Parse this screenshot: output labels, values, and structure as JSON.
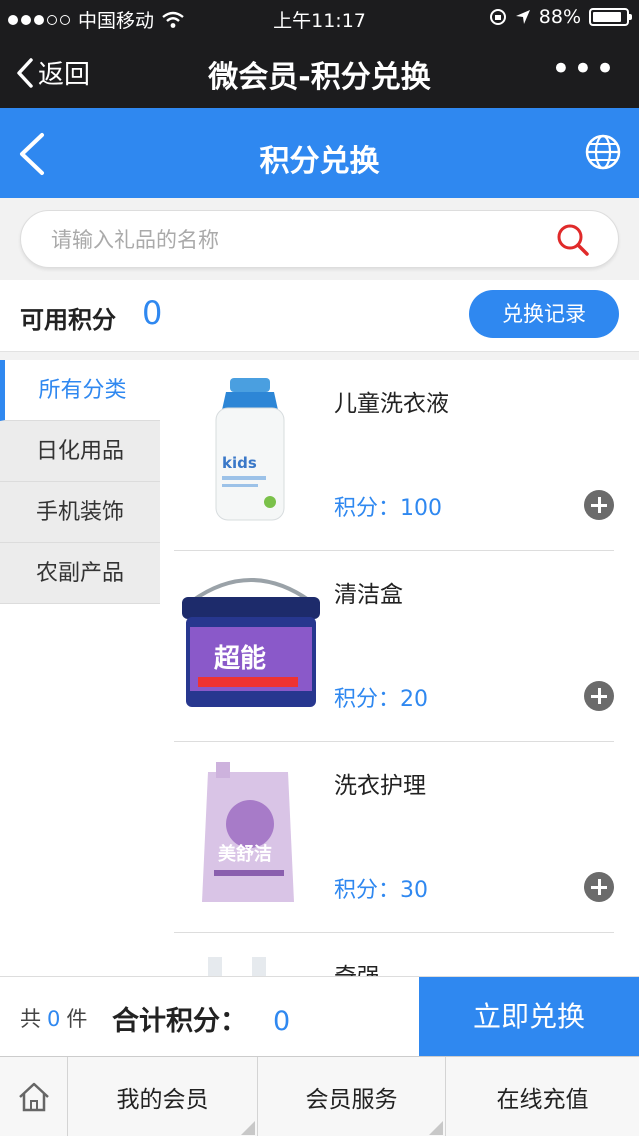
{
  "status_bar": {
    "carrier": "中国移动",
    "time": "上午11:17",
    "battery": "88%",
    "battery_level": 0.88
  },
  "wechat_nav": {
    "back_label": "返回",
    "title": "微会员-积分兑换",
    "more": "•••"
  },
  "header": {
    "title": "积分兑换",
    "back_icon": "chevron-left-icon",
    "globe_icon": "globe-icon"
  },
  "search": {
    "placeholder": "请输入礼品的名称",
    "icon": "search-icon"
  },
  "points": {
    "label": "可用积分",
    "value": "0",
    "history_button": "兑换记录"
  },
  "categories": [
    {
      "label": "所有分类",
      "active": true
    },
    {
      "label": "日化用品",
      "active": false
    },
    {
      "label": "手机装饰",
      "active": false
    },
    {
      "label": "农副产品",
      "active": false
    }
  ],
  "products": [
    {
      "name": "儿童洗衣液",
      "points": "积分：100",
      "image": "kids-detergent-bottle"
    },
    {
      "name": "清洁盒",
      "points": "积分：20",
      "image": "detergent-bucket"
    },
    {
      "name": "洗衣护理",
      "points": "积分：30",
      "image": "lavender-detergent-pouch"
    },
    {
      "name": "奇强",
      "points": "",
      "image": "detergent-bottles"
    }
  ],
  "cart": {
    "prefix": "共",
    "count": "0",
    "suffix": "件",
    "total_label": "合计积分：",
    "total_value": "0",
    "submit": "立即兑换"
  },
  "bottom_nav": {
    "home_icon": "home-icon",
    "items": [
      "我的会员",
      "会员服务",
      "在线充值"
    ]
  },
  "colors": {
    "accent": "#2f88f0",
    "dark_bar": "#1c1c1e",
    "add_button": "#6b6b6b"
  }
}
